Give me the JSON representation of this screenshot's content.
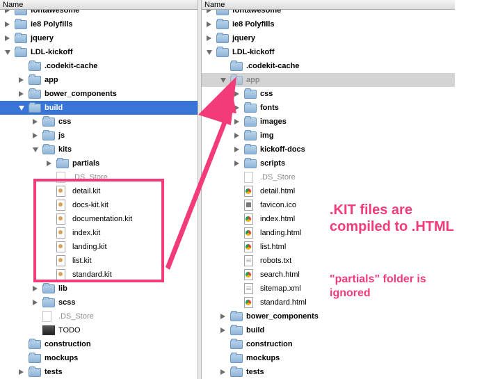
{
  "header": {
    "name_label": "Name"
  },
  "left_rows": [
    {
      "label": "fontawesome",
      "type": "folder",
      "disclosure": "closed",
      "indent": 0
    },
    {
      "label": "ie8 Polyfills",
      "type": "folder",
      "disclosure": "closed",
      "indent": 0
    },
    {
      "label": "jquery",
      "type": "folder",
      "disclosure": "closed",
      "indent": 0
    },
    {
      "label": "LDL-kickoff",
      "type": "folder",
      "disclosure": "open",
      "indent": 0
    },
    {
      "label": ".codekit-cache",
      "type": "folder",
      "disclosure": "none",
      "indent": 1
    },
    {
      "label": "app",
      "type": "folder",
      "disclosure": "closed",
      "indent": 1
    },
    {
      "label": "bower_components",
      "type": "folder",
      "disclosure": "closed",
      "indent": 1
    },
    {
      "label": "build",
      "type": "folder",
      "disclosure": "open",
      "indent": 1,
      "state": "selected"
    },
    {
      "label": "css",
      "type": "folder",
      "disclosure": "closed",
      "indent": 2
    },
    {
      "label": "js",
      "type": "folder",
      "disclosure": "closed",
      "indent": 2
    },
    {
      "label": "kits",
      "type": "folder",
      "disclosure": "open",
      "indent": 2
    },
    {
      "label": "partials",
      "type": "folder",
      "disclosure": "closed",
      "indent": 3
    },
    {
      "label": ".DS_Store",
      "type": "blank",
      "disclosure": "none",
      "indent": 3,
      "faded": true
    },
    {
      "label": "detail.kit",
      "type": "kit",
      "disclosure": "none",
      "indent": 3
    },
    {
      "label": "docs-kit.kit",
      "type": "kit",
      "disclosure": "none",
      "indent": 3
    },
    {
      "label": "documentation.kit",
      "type": "kit",
      "disclosure": "none",
      "indent": 3
    },
    {
      "label": "index.kit",
      "type": "kit",
      "disclosure": "none",
      "indent": 3
    },
    {
      "label": "landing.kit",
      "type": "kit",
      "disclosure": "none",
      "indent": 3
    },
    {
      "label": "list.kit",
      "type": "kit",
      "disclosure": "none",
      "indent": 3
    },
    {
      "label": "standard.kit",
      "type": "kit",
      "disclosure": "none",
      "indent": 3
    },
    {
      "label": "lib",
      "type": "folder",
      "disclosure": "closed",
      "indent": 2
    },
    {
      "label": "scss",
      "type": "folder",
      "disclosure": "closed",
      "indent": 2
    },
    {
      "label": ".DS_Store",
      "type": "blank",
      "disclosure": "none",
      "indent": 2,
      "faded": true
    },
    {
      "label": "TODO",
      "type": "terminal",
      "disclosure": "none",
      "indent": 2
    },
    {
      "label": "construction",
      "type": "folder",
      "disclosure": "none",
      "indent": 1
    },
    {
      "label": "mockups",
      "type": "folder",
      "disclosure": "none",
      "indent": 1
    },
    {
      "label": "tests",
      "type": "folder",
      "disclosure": "closed",
      "indent": 1
    }
  ],
  "right_rows": [
    {
      "label": "fontawesome",
      "type": "folder",
      "disclosure": "closed",
      "indent": 0
    },
    {
      "label": "ie8 Polyfills",
      "type": "folder",
      "disclosure": "closed",
      "indent": 0
    },
    {
      "label": "jquery",
      "type": "folder",
      "disclosure": "closed",
      "indent": 0
    },
    {
      "label": "LDL-kickoff",
      "type": "folder",
      "disclosure": "open",
      "indent": 0
    },
    {
      "label": ".codekit-cache",
      "type": "folder",
      "disclosure": "none",
      "indent": 1
    },
    {
      "label": "app",
      "type": "folder",
      "disclosure": "open",
      "indent": 1,
      "state": "dimmed"
    },
    {
      "label": "css",
      "type": "folder",
      "disclosure": "closed",
      "indent": 2
    },
    {
      "label": "fonts",
      "type": "folder",
      "disclosure": "closed",
      "indent": 2
    },
    {
      "label": "images",
      "type": "folder",
      "disclosure": "closed",
      "indent": 2
    },
    {
      "label": "img",
      "type": "folder",
      "disclosure": "closed",
      "indent": 2
    },
    {
      "label": "kickoff-docs",
      "type": "folder",
      "disclosure": "closed",
      "indent": 2
    },
    {
      "label": "scripts",
      "type": "folder",
      "disclosure": "closed",
      "indent": 2
    },
    {
      "label": ".DS_Store",
      "type": "blank",
      "disclosure": "none",
      "indent": 2,
      "faded": true
    },
    {
      "label": "detail.html",
      "type": "html",
      "disclosure": "none",
      "indent": 2
    },
    {
      "label": "favicon.ico",
      "type": "ico",
      "disclosure": "none",
      "indent": 2
    },
    {
      "label": "index.html",
      "type": "html",
      "disclosure": "none",
      "indent": 2
    },
    {
      "label": "landing.html",
      "type": "html",
      "disclosure": "none",
      "indent": 2
    },
    {
      "label": "list.html",
      "type": "html",
      "disclosure": "none",
      "indent": 2
    },
    {
      "label": "robots.txt",
      "type": "txt",
      "disclosure": "none",
      "indent": 2
    },
    {
      "label": "search.html",
      "type": "html",
      "disclosure": "none",
      "indent": 2
    },
    {
      "label": "sitemap.xml",
      "type": "txt",
      "disclosure": "none",
      "indent": 2
    },
    {
      "label": "standard.html",
      "type": "html",
      "disclosure": "none",
      "indent": 2
    },
    {
      "label": "bower_components",
      "type": "folder",
      "disclosure": "closed",
      "indent": 1
    },
    {
      "label": "build",
      "type": "folder",
      "disclosure": "closed",
      "indent": 1
    },
    {
      "label": "construction",
      "type": "folder",
      "disclosure": "none",
      "indent": 1
    },
    {
      "label": "mockups",
      "type": "folder",
      "disclosure": "none",
      "indent": 1
    },
    {
      "label": "tests",
      "type": "folder",
      "disclosure": "closed",
      "indent": 1
    }
  ],
  "annotations": {
    "compiled": ".KIT files are compiled to .HTML",
    "partials_ignored": "\"partials\" folder is ignored"
  },
  "colors": {
    "selection": "#3875d7",
    "annotation": "#f23b78"
  }
}
